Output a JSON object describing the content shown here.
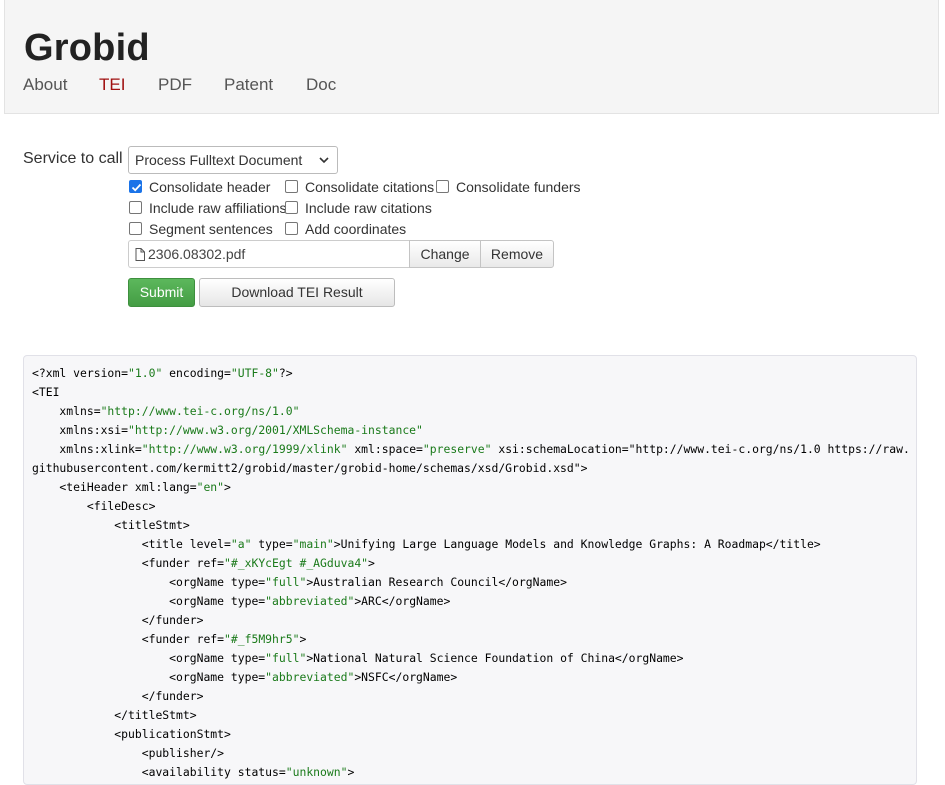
{
  "header": {
    "title": "Grobid",
    "nav": [
      "About",
      "TEI",
      "PDF",
      "Patent",
      "Doc"
    ],
    "active_nav": "TEI",
    "active_color": "#a01010"
  },
  "form": {
    "service_label": "Service to call",
    "service_selected": "Process Fulltext Document",
    "checkboxes": [
      {
        "label": "Consolidate header",
        "checked": true
      },
      {
        "label": "Consolidate citations",
        "checked": false
      },
      {
        "label": "Consolidate funders",
        "checked": false
      },
      {
        "label": "Include raw affiliations",
        "checked": false
      },
      {
        "label": "Include raw citations",
        "checked": false
      },
      {
        "label": "Segment sentences",
        "checked": false
      },
      {
        "label": "Add coordinates",
        "checked": false
      }
    ],
    "file_name": "2306.08302.pdf",
    "change_label": "Change",
    "remove_label": "Remove",
    "submit_label": "Submit",
    "download_label": "Download TEI Result",
    "submit_color": "#5cb85c"
  },
  "code": {
    "lines": [
      "<?xml version=\"1.0\" encoding=\"UTF-8\"?>",
      "<TEI",
      "    xmlns=\"http://www.tei-c.org/ns/1.0\"",
      "    xmlns:xsi=\"http://www.w3.org/2001/XMLSchema-instance\"",
      "    xmlns:xlink=\"http://www.w3.org/1999/xlink\" xml:space=\"preserve\" xsi:schemaLocation=\"http://www.tei-c.org/ns/1.0 https://raw.",
      "githubusercontent.com/kermitt2/grobid/master/grobid-home/schemas/xsd/Grobid.xsd\">",
      "    <teiHeader xml:lang=\"en\">",
      "        <fileDesc>",
      "            <titleStmt>",
      "                <title level=\"a\" type=\"main\">Unifying Large Language Models and Knowledge Graphs: A Roadmap</title>",
      "                <funder ref=\"#_xKYcEgt #_AGduva4\">",
      "                    <orgName type=\"full\">Australian Research Council</orgName>",
      "                    <orgName type=\"abbreviated\">ARC</orgName>",
      "                </funder>",
      "                <funder ref=\"#_f5M9hr5\">",
      "                    <orgName type=\"full\">National Natural Science Foundation of China</orgName>",
      "                    <orgName type=\"abbreviated\">NSFC</orgName>",
      "                </funder>",
      "            </titleStmt>",
      "            <publicationStmt>",
      "                <publisher/>",
      "                <availability status=\"unknown\">"
    ]
  }
}
